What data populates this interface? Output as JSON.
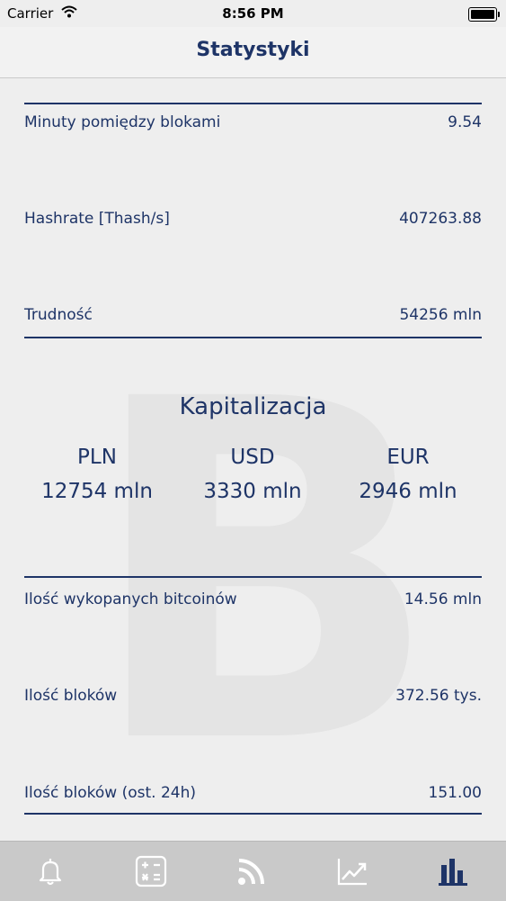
{
  "status_bar": {
    "carrier": "Carrier",
    "time": "8:56 PM"
  },
  "nav": {
    "title": "Statystyki"
  },
  "stats_top": [
    {
      "label": "Minuty pomiędzy blokami",
      "value": "9.54"
    },
    {
      "label": "Hashrate [Thash/s]",
      "value": "407263.88"
    },
    {
      "label": "Trudność",
      "value": "54256 mln"
    }
  ],
  "capitalization": {
    "title": "Kapitalizacja",
    "currencies": [
      {
        "currency": "PLN",
        "amount": "12754 mln"
      },
      {
        "currency": "USD",
        "amount": "3330 mln"
      },
      {
        "currency": "EUR",
        "amount": "2946 mln"
      }
    ]
  },
  "stats_bottom": [
    {
      "label": "Ilość wykopanych bitcoinów",
      "value": "14.56 mln"
    },
    {
      "label": "Ilość bloków",
      "value": "372.56 tys."
    },
    {
      "label": "Ilość bloków (ost. 24h)",
      "value": "151.00"
    }
  ],
  "watermark": {
    "glyph": "B"
  },
  "tab_bar": {
    "tabs": [
      {
        "icon": "bell-icon",
        "active": false
      },
      {
        "icon": "calculator-icon",
        "active": false
      },
      {
        "icon": "rss-icon",
        "active": false
      },
      {
        "icon": "line-chart-icon",
        "active": false
      },
      {
        "icon": "bar-chart-icon",
        "active": true
      }
    ]
  },
  "colors": {
    "accent": "#1e3467",
    "inactive_icon": "#ffffff",
    "tab_bar_bg": "#c9c9c9"
  }
}
